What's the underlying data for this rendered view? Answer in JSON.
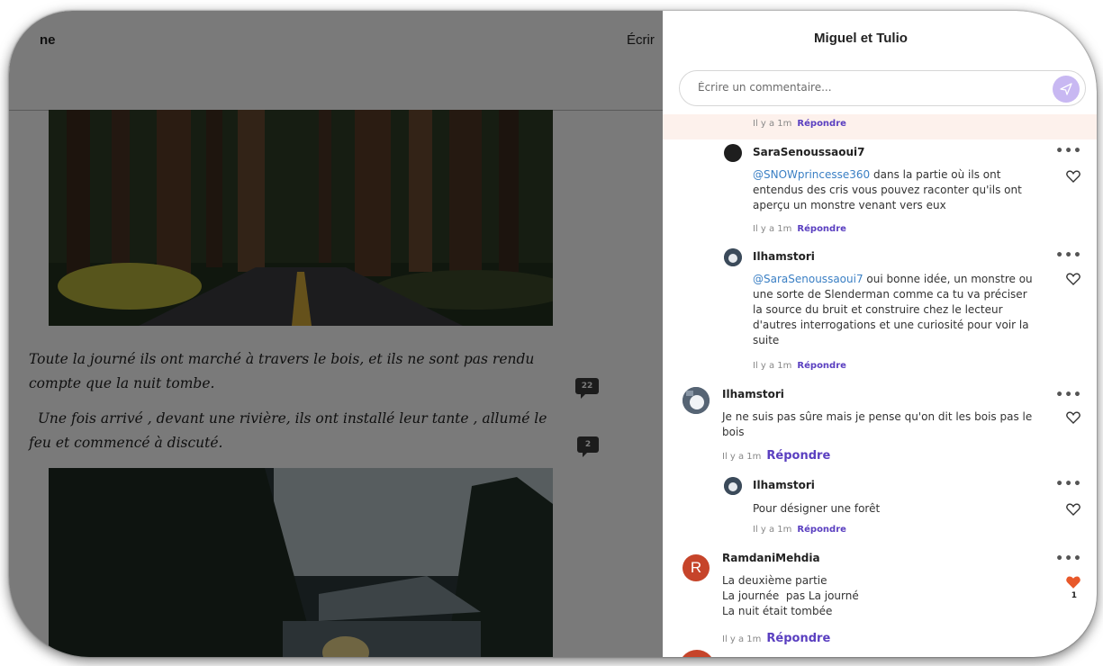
{
  "story": {
    "brand": "ne",
    "write_link": "Écrir",
    "paragraphs": [
      "Toute la journé ils ont marché à travers le bois, et ils ne sont pas rendu compte que la nuit tombe.",
      "  Une fois arrivé , devant une rivière, ils ont installé leur tante , allumé le feu et commencé à discuté."
    ],
    "comment_counts": [
      "22",
      "2"
    ]
  },
  "panel": {
    "title": "Miguel et Tulio",
    "input_placeholder": "Écrire un commentaire...",
    "first_meta": {
      "time": "Il y a 1m",
      "reply": "Répondre"
    },
    "comments": [
      {
        "user": "SaraSenoussaoui7",
        "mention": "@SNOWprincesse360",
        "text": " dans la partie où ils ont entendus des cris vous pouvez raconter qu'ils ont aperçu un monstre venant vers eux",
        "time": "Il y a 1m",
        "reply": "Répondre",
        "more": "•••"
      },
      {
        "user": "Ilhamstori",
        "mention": "@SaraSenoussaoui7",
        "text": " oui bonne idée, un monstre ou une sorte de Slenderman comme ca tu va préciser la source du bruit et construire chez le lecteur d'autres interrogations et une curiosité pour voir la suite",
        "time": "Il y a 1m",
        "reply": "Répondre",
        "more": "•••"
      },
      {
        "user": "Ilhamstori",
        "text": "Je ne suis pas sûre mais je pense qu'on dit les bois pas le bois",
        "time": "Il y a 1m",
        "reply": "Répondre",
        "more": "•••"
      },
      {
        "user": "Ilhamstori",
        "text": "Pour désigner une forêt",
        "time": "Il y a 1m",
        "reply": "Répondre",
        "more": "•••"
      },
      {
        "user": "RamdaniMehdia",
        "avatar_letter": "R",
        "lines": [
          "La deuxième partie",
          "La journée  pas La journé",
          "La nuit était tombée"
        ],
        "time": "Il y a 1m",
        "reply": "Répondre",
        "more": "•••",
        "likes": "1",
        "liked": true
      }
    ]
  },
  "colors": {
    "accent": "#5a3fc0",
    "liked_heart": "#e8582a",
    "avatar_r": "#c6442a",
    "send": "#c8b8f2"
  }
}
